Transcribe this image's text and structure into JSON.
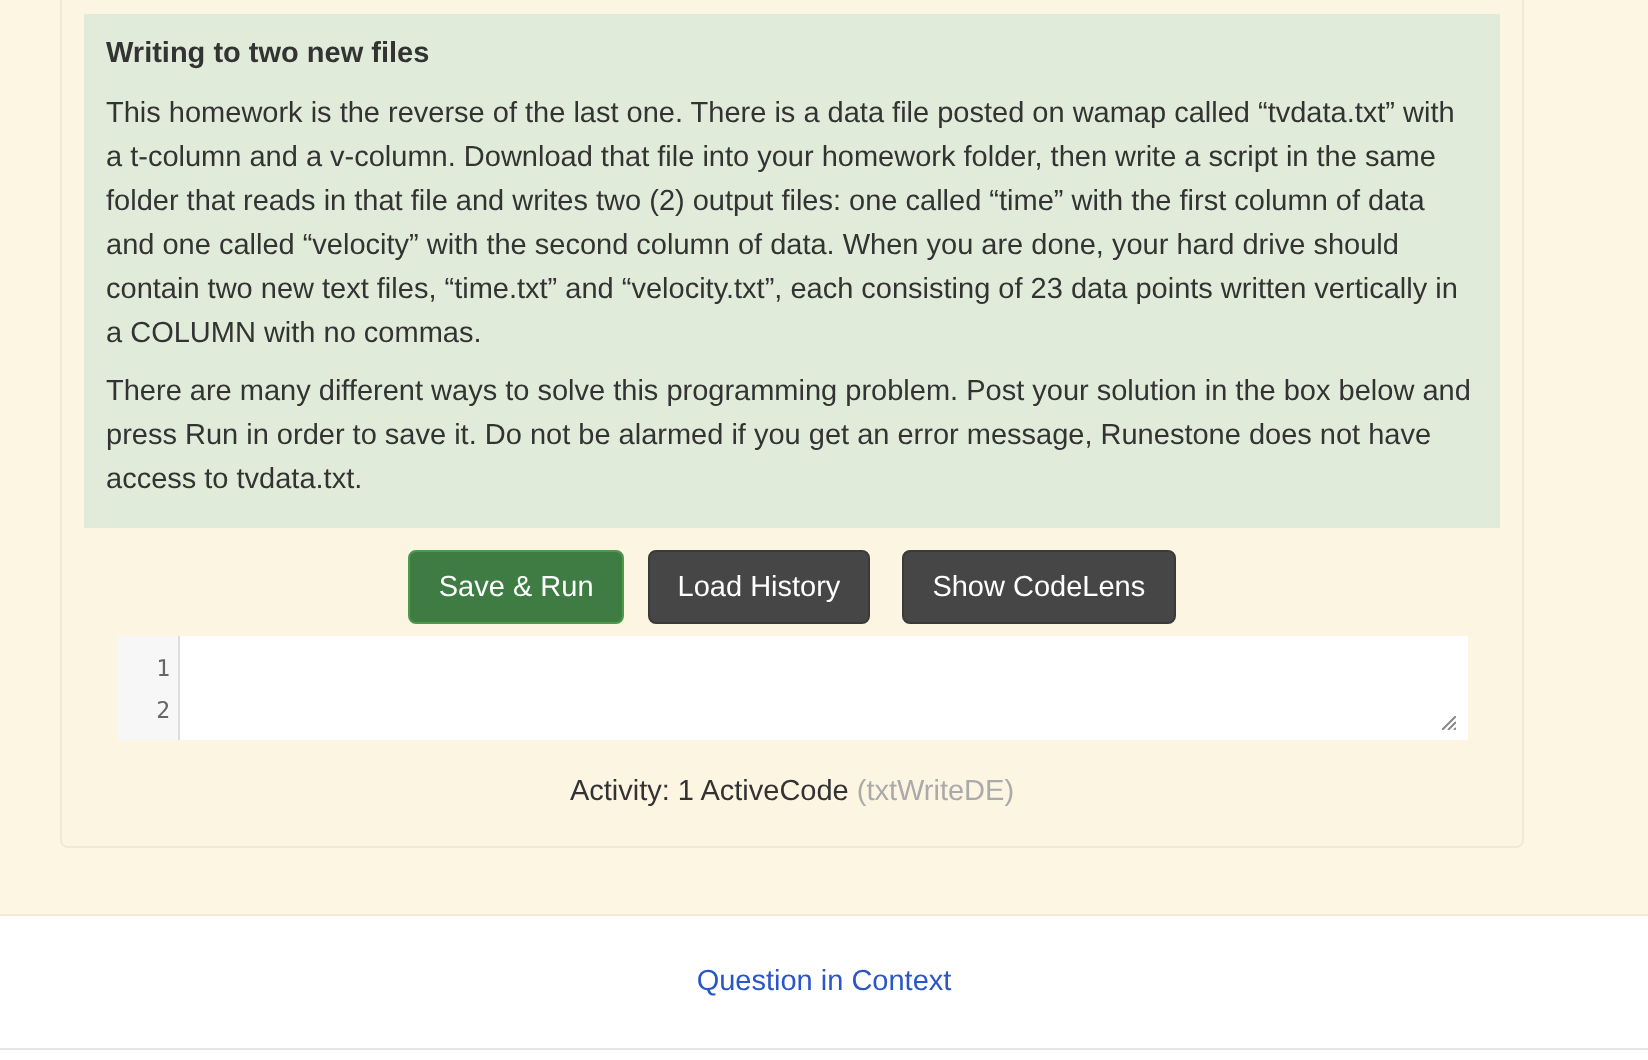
{
  "question": {
    "title": "Writing to two new files",
    "paragraphs": [
      "This homework is the reverse of the last one. There is a data file posted on wamap called “tvdata.txt” with a t-column and a v-column. Download that file into your homework folder, then write a script in the same folder that reads in that file and writes two (2) output files: one called “time” with the first column of data and one called “velocity” with the second column of data. When you are done, your hard drive should contain two new text files, “time.txt” and “velocity.txt”, each consisting of 23 data points written vertically in a COLUMN with no commas.",
      "There are many different ways to solve this programming problem. Post your solution in the box below and press Run in order to save it. Do not be alarmed if you get an error message, Runestone does not have access to tvdata.txt."
    ]
  },
  "buttons": [
    {
      "label": "Save & Run",
      "kind": "primary"
    },
    {
      "label": "Load History",
      "kind": "default"
    },
    {
      "label": "Show CodeLens",
      "kind": "default"
    }
  ],
  "editor": {
    "line_numbers": [
      "1",
      "2"
    ]
  },
  "activity": {
    "label": "Activity: 1 ActiveCode",
    "id": "(txtWriteDE)"
  },
  "footer": {
    "link": "Question in Context"
  }
}
